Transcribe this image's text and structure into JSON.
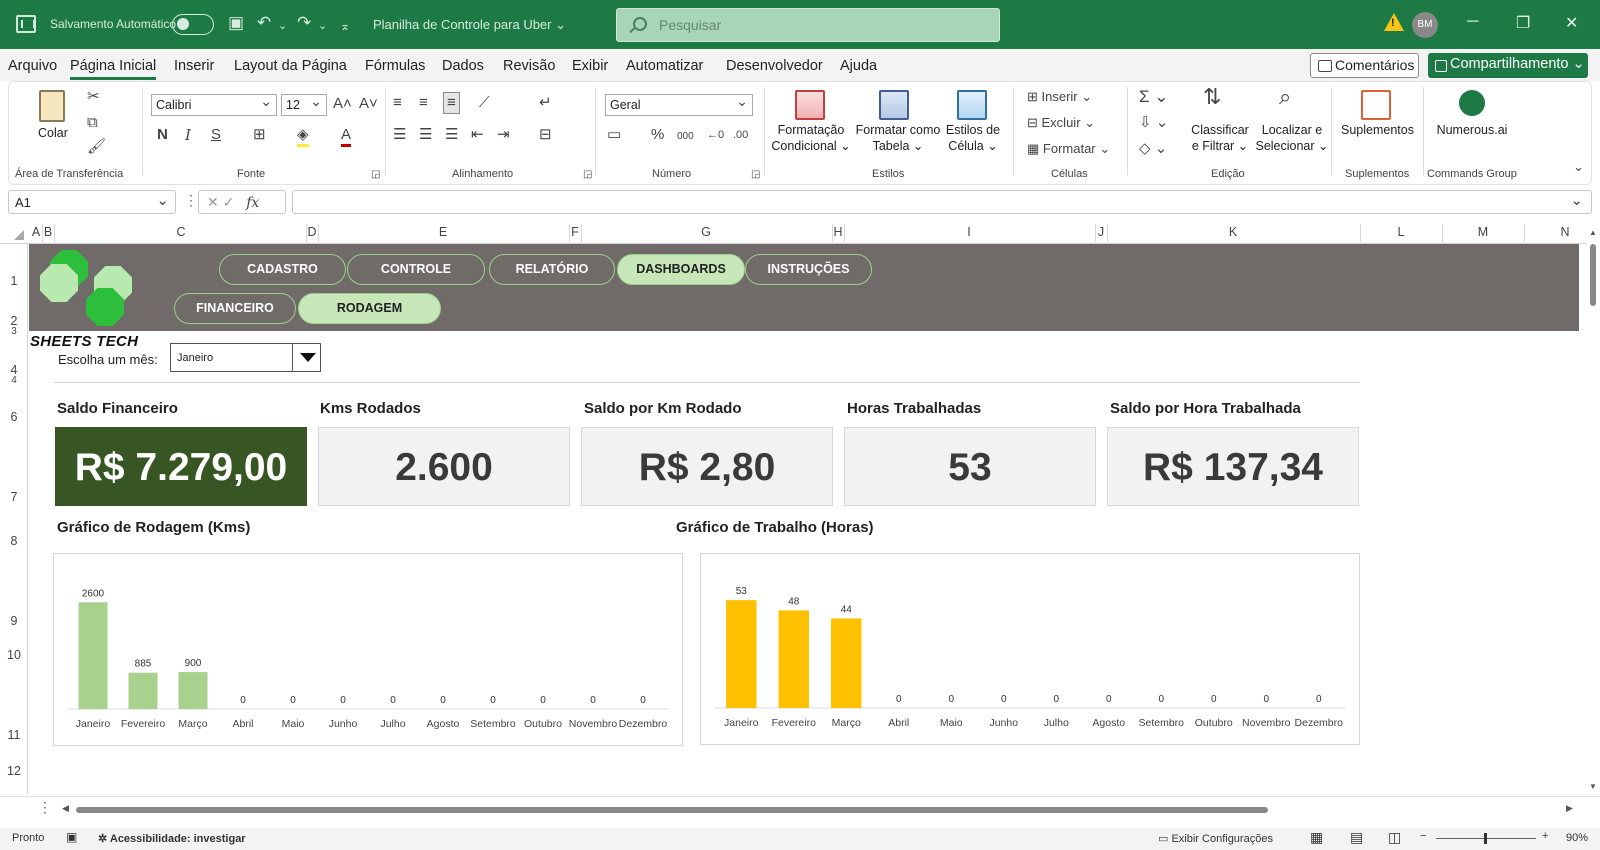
{
  "titlebar": {
    "autosave_label": "Salvamento Automático",
    "filename": "Planilha de Controle para Uber",
    "search_placeholder": "Pesquisar",
    "avatar_initials": "BM"
  },
  "menu": {
    "items": [
      "Arquivo",
      "Página Inicial",
      "Inserir",
      "Layout da Página",
      "Fórmulas",
      "Dados",
      "Revisão",
      "Exibir",
      "Automatizar",
      "Desenvolvedor",
      "Ajuda"
    ],
    "active": "Página Inicial",
    "comments_label": "Comentários",
    "share_label": "Compartilhamento"
  },
  "ribbon": {
    "clipboard": {
      "paste_label": "Colar",
      "group_label": "Área de Transferência"
    },
    "font": {
      "name": "Calibri",
      "size": "12",
      "bold": "N",
      "italic": "I",
      "underline": "S",
      "group_label": "Fonte"
    },
    "alignment": {
      "group_label": "Alinhamento"
    },
    "number": {
      "format": "Geral",
      "group_label": "Número"
    },
    "styles": {
      "conditional": "Formatação Condicional",
      "conditional_l1": "Formatação",
      "conditional_l2": "Condicional",
      "as_table_l1": "Formatar como",
      "as_table_l2": "Tabela",
      "cell_styles_l1": "Estilos de",
      "cell_styles_l2": "Célula",
      "group_label": "Estilos"
    },
    "cells": {
      "insert": "Inserir",
      "delete": "Excluir",
      "format": "Formatar",
      "group_label": "Células"
    },
    "editing": {
      "sort_l1": "Classificar",
      "sort_l2": "e Filtrar",
      "find_l1": "Localizar e",
      "find_l2": "Selecionar",
      "group_label": "Edição"
    },
    "addins": {
      "label": "Suplementos",
      "group_label": "Suplementos"
    },
    "commands": {
      "label": "Numerous.ai",
      "group_label": "Commands Group"
    }
  },
  "formula_bar": {
    "name_box": "A1",
    "fx": "fx",
    "value": ""
  },
  "sheet": {
    "columns": [
      "A",
      "B",
      "C",
      "D",
      "E",
      "F",
      "G",
      "H",
      "I",
      "J",
      "K",
      "L",
      "M",
      "N"
    ],
    "rows": [
      "1",
      "2",
      "3",
      "4",
      "4",
      "6",
      "7",
      "8",
      "9",
      "10",
      "11",
      "12"
    ]
  },
  "dashboard": {
    "brand": "SHEETS TECH",
    "nav_top": [
      "CADASTRO",
      "CONTROLE",
      "RELATÓRIO",
      "DASHBOARDS",
      "INSTRUÇÕES"
    ],
    "nav_top_active": "DASHBOARDS",
    "nav_sub": [
      "FINANCEIRO",
      "RODAGEM"
    ],
    "nav_sub_active": "RODAGEM",
    "month_label": "Escolha um mês:",
    "month_value": "Janeiro",
    "kpis": [
      {
        "title": "Saldo Financeiro",
        "value": "R$ 7.279,00"
      },
      {
        "title": "Kms Rodados",
        "value": "2.600"
      },
      {
        "title": "Saldo por Km Rodado",
        "value": "R$ 2,80"
      },
      {
        "title": "Horas Trabalhadas",
        "value": "53"
      },
      {
        "title": "Saldo por Hora Trabalhada",
        "value": "R$ 137,34"
      }
    ]
  },
  "chart_data": [
    {
      "type": "bar",
      "title": "Gráfico de Rodagem (Kms)",
      "categories": [
        "Janeiro",
        "Fevereiro",
        "Março",
        "Abril",
        "Maio",
        "Junho",
        "Julho",
        "Agosto",
        "Setembro",
        "Outubro",
        "Novembro",
        "Dezembro"
      ],
      "values": [
        2600,
        885,
        900,
        0,
        0,
        0,
        0,
        0,
        0,
        0,
        0,
        0
      ],
      "color": "#a9d18e",
      "ylim": [
        0,
        2900
      ],
      "grid": false,
      "data_labels": true
    },
    {
      "type": "bar",
      "title": "Gráfico de Trabalho (Horas)",
      "categories": [
        "Janeiro",
        "Fevereiro",
        "Março",
        "Abril",
        "Maio",
        "Junho",
        "Julho",
        "Agosto",
        "Setembro",
        "Outubro",
        "Novembro",
        "Dezembro"
      ],
      "values": [
        53,
        48,
        44,
        0,
        0,
        0,
        0,
        0,
        0,
        0,
        0,
        0
      ],
      "color": "#ffc000",
      "ylim": [
        0,
        58
      ],
      "grid": false,
      "data_labels": true
    }
  ],
  "statusbar": {
    "ready": "Pronto",
    "accessibility": "Acessibilidade: investigar",
    "display_settings": "Exibir Configurações",
    "zoom": "90%"
  }
}
